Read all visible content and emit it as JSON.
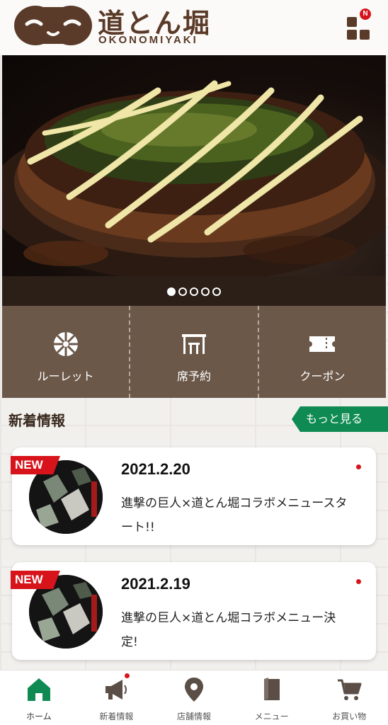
{
  "header": {
    "logo_text": "道とん堀",
    "logo_sub": "OKONOMIYAKI",
    "menu_badge": "N"
  },
  "hero": {
    "slides_total": 5,
    "active_slide": 1
  },
  "quick_menu": [
    {
      "label": "ルーレット",
      "icon": "roulette-icon"
    },
    {
      "label": "席予約",
      "icon": "seat-reservation-icon"
    },
    {
      "label": "クーポン",
      "icon": "coupon-icon"
    }
  ],
  "news": {
    "title": "新着情報",
    "more_label": "もっと見る",
    "items": [
      {
        "badge": "NEW",
        "date": "2021.2.20",
        "text": "進撃の巨人×道とん堀コラボメニュースタート!!"
      },
      {
        "badge": "NEW",
        "date": "2021.2.19",
        "text": "進撃の巨人×道とん堀コラボメニュー決定!"
      }
    ]
  },
  "bottom_nav": [
    {
      "label": "ホーム",
      "icon": "home-icon",
      "active": true
    },
    {
      "label": "新着情報",
      "icon": "megaphone-icon",
      "badge": true
    },
    {
      "label": "店舗情報",
      "icon": "map-pin-icon"
    },
    {
      "label": "メニュー",
      "icon": "book-icon"
    },
    {
      "label": "お買い物",
      "icon": "cart-icon"
    }
  ],
  "colors": {
    "brand_brown": "#5a3a28",
    "panel_brown": "#6b5849",
    "accent_green": "#0e8a52",
    "alert_red": "#d7141c"
  }
}
